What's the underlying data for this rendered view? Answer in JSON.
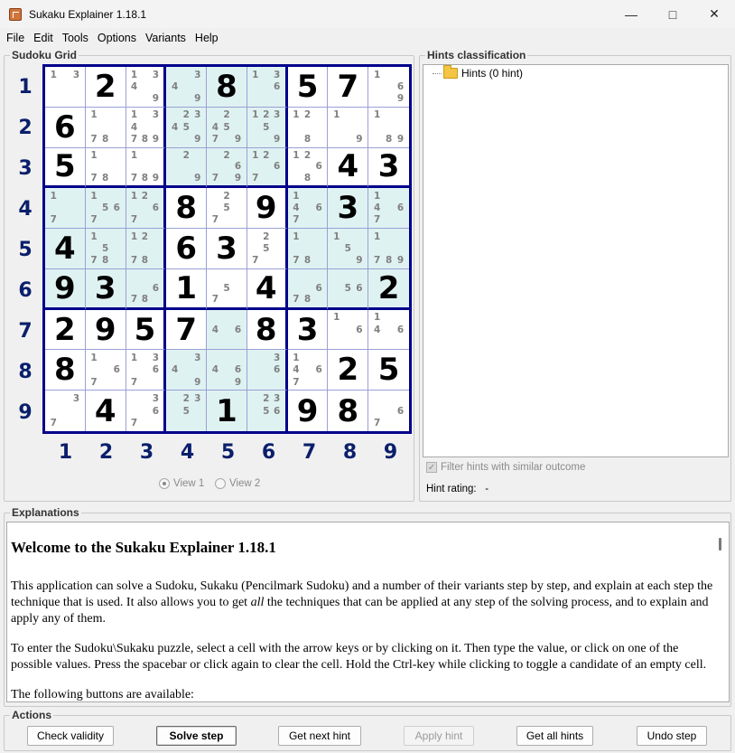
{
  "window": {
    "title": "Sukaku Explainer 1.18.1"
  },
  "menu": [
    "File",
    "Edit",
    "Tools",
    "Options",
    "Variants",
    "Help"
  ],
  "grid_panel": {
    "title": "Sudoku Grid",
    "row_labels": [
      "1",
      "2",
      "3",
      "4",
      "5",
      "6",
      "7",
      "8",
      "9"
    ],
    "col_labels": [
      "1",
      "2",
      "3",
      "4",
      "5",
      "6",
      "7",
      "8",
      "9"
    ]
  },
  "cells": [
    [
      {
        "c": "13"
      },
      {
        "v": "2"
      },
      {
        "c": "1349"
      },
      {
        "c": "349",
        "s": 1
      },
      {
        "v": "8",
        "s": 1
      },
      {
        "c": "136",
        "s": 1
      },
      {
        "v": "5"
      },
      {
        "v": "7"
      },
      {
        "c": "169"
      }
    ],
    [
      {
        "v": "6"
      },
      {
        "c": "178"
      },
      {
        "c": "134789"
      },
      {
        "c": "234599",
        "s": 1
      },
      {
        "c": "24579",
        "s": 1
      },
      {
        "c": "12359",
        "s": 1
      },
      {
        "c": "128"
      },
      {
        "c": "19"
      },
      {
        "c": "189"
      }
    ],
    [
      {
        "v": "5"
      },
      {
        "c": "178"
      },
      {
        "c": "1789"
      },
      {
        "c": "29",
        "s": 1
      },
      {
        "c": "2679",
        "s": 1
      },
      {
        "c": "1267",
        "s": 1
      },
      {
        "c": "1268"
      },
      {
        "v": "4"
      },
      {
        "v": "3"
      }
    ],
    [
      {
        "c": "17",
        "s": 1
      },
      {
        "c": "1567",
        "s": 1
      },
      {
        "c": "1267",
        "s": 1
      },
      {
        "v": "8"
      },
      {
        "c": "257"
      },
      {
        "v": "9"
      },
      {
        "c": "1467",
        "s": 1
      },
      {
        "v": "3",
        "s": 1
      },
      {
        "c": "1467",
        "s": 1
      }
    ],
    [
      {
        "v": "4",
        "s": 1
      },
      {
        "c": "1578",
        "s": 1
      },
      {
        "c": "1278",
        "s": 1
      },
      {
        "v": "6"
      },
      {
        "v": "3"
      },
      {
        "c": "257"
      },
      {
        "c": "178",
        "s": 1
      },
      {
        "c": "159",
        "s": 1
      },
      {
        "c": "1789",
        "s": 1
      }
    ],
    [
      {
        "v": "9",
        "s": 1
      },
      {
        "v": "3",
        "s": 1
      },
      {
        "c": "678",
        "s": 1
      },
      {
        "v": "1"
      },
      {
        "c": "57"
      },
      {
        "v": "4"
      },
      {
        "c": "678",
        "s": 1
      },
      {
        "c": "56",
        "s": 1
      },
      {
        "v": "2",
        "s": 1
      }
    ],
    [
      {
        "v": "2"
      },
      {
        "v": "9"
      },
      {
        "v": "5"
      },
      {
        "v": "7"
      },
      {
        "c": "46",
        "s": 1
      },
      {
        "v": "8"
      },
      {
        "v": "3"
      },
      {
        "c": "16"
      },
      {
        "c": "146"
      }
    ],
    [
      {
        "v": "8"
      },
      {
        "c": "167"
      },
      {
        "c": "1367"
      },
      {
        "c": "349",
        "s": 1
      },
      {
        "c": "469",
        "s": 1
      },
      {
        "c": "36",
        "s": 1
      },
      {
        "c": "1467"
      },
      {
        "v": "2"
      },
      {
        "v": "5"
      }
    ],
    [
      {
        "c": "37"
      },
      {
        "v": "4"
      },
      {
        "c": "367"
      },
      {
        "c": "235",
        "s": 1
      },
      {
        "v": "1",
        "s": 1
      },
      {
        "c": "2356",
        "s": 1
      },
      {
        "v": "9"
      },
      {
        "v": "8"
      },
      {
        "c": "67"
      }
    ]
  ],
  "view_options": {
    "view1": "View 1",
    "view2": "View 2",
    "selected": "View 1"
  },
  "hints_panel": {
    "title": "Hints classification",
    "tree_root": "Hints (0 hint)",
    "filter_label": "Filter hints with similar outcome",
    "filter_checked": true,
    "rating_label": "Hint rating:",
    "rating_value": "-"
  },
  "explanations": {
    "title": "Explanations",
    "heading": "Welcome to the Sukaku Explainer 1.18.1",
    "p1_a": "This application can solve a Sudoku, Sukaku (Pencilmark Sudoku) and a number of their variants step by step, and explain at each step the technique that is used. It also allows you to get ",
    "p1_em": "all",
    "p1_b": " the techniques that can be applied at any step of the solving process, and to explain and apply any of them.",
    "p2": "To enter the Sudoku\\Sukaku puzzle, select a cell with the arrow keys or by clicking on it. Then type the value, or click on one of the possible values. Press the spacebar or click again to clear the cell. Hold the Ctrl-key while clicking to toggle a candidate of an empty cell.",
    "p3": "The following buttons are available:"
  },
  "actions": {
    "title": "Actions",
    "check_validity": "Check validity",
    "solve_step": "Solve step",
    "get_next_hint": "Get next hint",
    "apply_hint": "Apply hint",
    "get_all_hints": "Get all hints",
    "undo_step": "Undo step"
  }
}
